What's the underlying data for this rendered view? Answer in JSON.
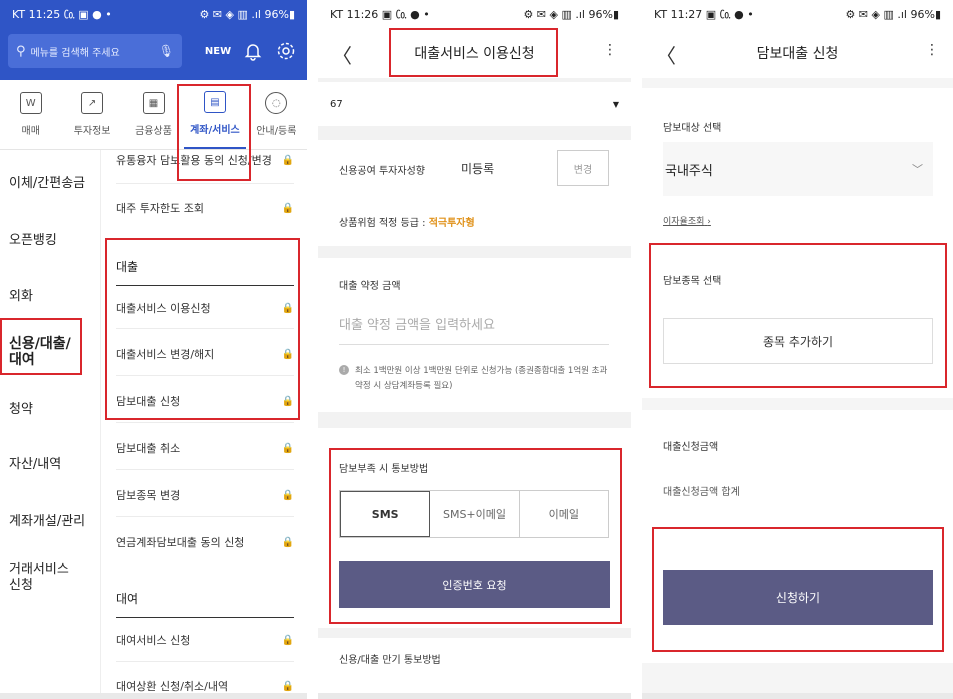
{
  "panel1": {
    "status": {
      "time": "KT 11:25",
      "icons_left": "㏇ ▣ ●  •",
      "battery": "96%"
    },
    "search_placeholder": "메뉴를 검색해 주세요",
    "new_label": "NEW",
    "tabs": [
      {
        "label": "매매",
        "icon": "W"
      },
      {
        "label": "투자정보",
        "icon": "↗"
      },
      {
        "label": "금융상품",
        "icon": "▦"
      },
      {
        "label": "계좌/서비스",
        "icon": "▤"
      },
      {
        "label": "안내/등록",
        "icon": "◌"
      }
    ],
    "left_nav": [
      "이체/간편송금",
      "오픈뱅킹",
      "외화",
      "신용/대출/\n대여",
      "청약",
      "자산/내역",
      "계좌개설/관리",
      "거래서비스\n신청"
    ],
    "right_items_top": [
      "유통융자 담보활용 동의 신청/변경",
      "대주 투자한도 조회"
    ],
    "section_loan": "대출",
    "loan_items": [
      "대출서비스 이용신청",
      "대출서비스 변경/해지",
      "담보대출 신청",
      "담보대출 취소",
      "담보종목 변경",
      "연금계좌담보대출 동의 신청"
    ],
    "section_lend": "대여",
    "lend_items": [
      "대여서비스 신청",
      "대여상환 신청/취소/내역"
    ]
  },
  "panel2": {
    "status": {
      "time": "KT 11:26",
      "icons_left": "▣ ㏇ ●  •",
      "battery": "96%"
    },
    "title": "대출서비스 이용신청",
    "account_prefix": "67",
    "propensity_label": "신용공여 투자자성향",
    "propensity_value": "미등록",
    "change_button": "변경",
    "risk_grade_label": "상품위험 적정 등급 : ",
    "risk_grade_value": "적극투자형",
    "amount_label": "대출 약정 금액",
    "amount_placeholder": "대출 약정 금액을 입력하세요",
    "note": "최소 1백만원 이상 1백만원 단위로 신청가능 (종권종합대출 1억원 초과 약정 시 상담계좌등록 필요)",
    "notify_label": "담보부족 시 통보방법",
    "notify_options": [
      "SMS",
      "SMS+이메일",
      "이메일"
    ],
    "request_button": "인증번호 요청",
    "maturity_label": "신용/대출 만기 통보방법"
  },
  "panel3": {
    "status": {
      "time": "KT 11:27",
      "icons_left": "▣ ㏇ ●  •",
      "battery": "96%"
    },
    "title": "담보대출 신청",
    "collateral_label": "담보대상 선택",
    "collateral_value": "국내주식",
    "rate_link": "이자율조회",
    "stock_label": "담보종목 선택",
    "add_stock_button": "종목 추가하기",
    "amount_label": "대출신청금액",
    "total_label": "대출신청금액 합계",
    "apply_button": "신청하기"
  },
  "colors": {
    "brand_blue": "#2f55c6",
    "primary_button": "#5b5b85",
    "highlight_red": "#d9262c",
    "risk_orange": "#e0921a"
  }
}
